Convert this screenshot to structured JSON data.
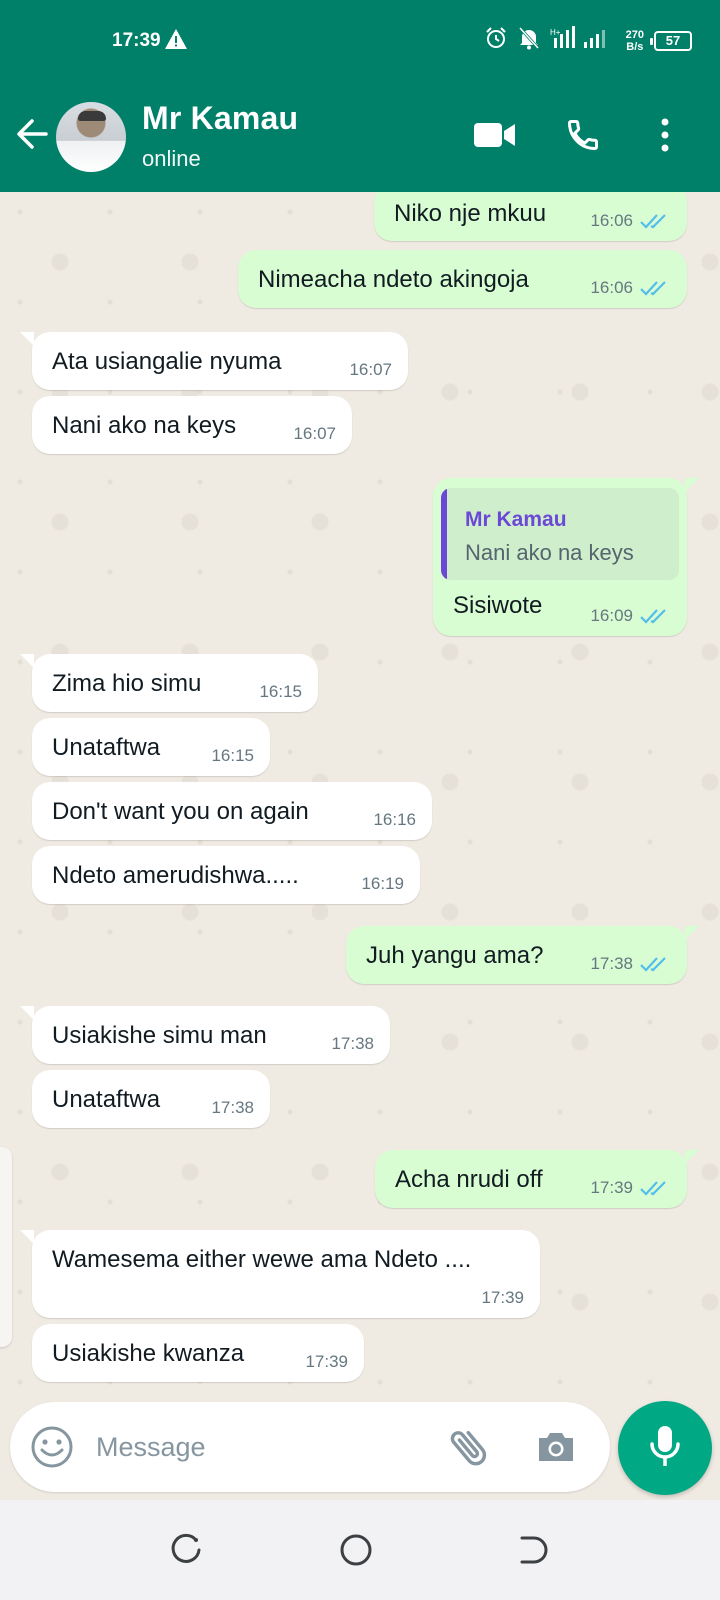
{
  "status_bar": {
    "time": "17:39",
    "net_speed_value": "270",
    "net_speed_unit": "B/s",
    "battery": "57"
  },
  "header": {
    "contact_name": "Mr Kamau",
    "contact_status": "online"
  },
  "messages": [
    {
      "dir": "out",
      "text": "Niko nje mkuu",
      "time": "16:06",
      "read": true
    },
    {
      "dir": "out",
      "text": "Nimeacha ndeto akingoja",
      "time": "16:06",
      "read": true
    },
    {
      "dir": "in",
      "text": "Ata usiangalie nyuma",
      "time": "16:07"
    },
    {
      "dir": "in",
      "text": "Nani ako na keys",
      "time": "16:07"
    },
    {
      "dir": "out",
      "text": "Sisiwote",
      "time": "16:09",
      "read": true,
      "reply_to": {
        "name": "Mr Kamau",
        "text": "Nani ako na keys"
      }
    },
    {
      "dir": "in",
      "text": "Zima hio simu",
      "time": "16:15"
    },
    {
      "dir": "in",
      "text": "Unataftwa",
      "time": "16:15"
    },
    {
      "dir": "in",
      "text": "Don't want you on again",
      "time": "16:16"
    },
    {
      "dir": "in",
      "text": "Ndeto amerudishwa.....",
      "time": "16:19"
    },
    {
      "dir": "out",
      "text": "Juh yangu ama?",
      "time": "17:38",
      "read": true
    },
    {
      "dir": "in",
      "text": "Usiakishe simu man",
      "time": "17:38"
    },
    {
      "dir": "in",
      "text": "Unataftwa",
      "time": "17:38"
    },
    {
      "dir": "out",
      "text": "Acha nrudi off",
      "time": "17:39",
      "read": true
    },
    {
      "dir": "in",
      "text": "Wamesema either wewe ama Ndeto ....",
      "time": "17:39"
    },
    {
      "dir": "in",
      "text": "Usiakishe kwanza",
      "time": "17:39"
    }
  ],
  "input": {
    "placeholder": "Message",
    "value": ""
  },
  "colors": {
    "header": "#008069",
    "chat_bg": "#efeae2",
    "bubble_out": "#d9fdd3",
    "bubble_in": "#ffffff",
    "read_ticks": "#53bdeb",
    "mic_button": "#00a884",
    "reply_accent": "#6b48d6"
  },
  "icons": {
    "status": [
      "warning-icon",
      "alarm-icon",
      "bell-off-icon",
      "signal-icon",
      "battery-icon"
    ],
    "header": [
      "back-arrow-icon",
      "video-call-icon",
      "phone-icon",
      "more-vert-icon"
    ],
    "input": [
      "emoji-icon",
      "attach-icon",
      "camera-icon",
      "mic-icon"
    ],
    "nav": [
      "recents-icon",
      "home-icon",
      "back-icon"
    ]
  }
}
